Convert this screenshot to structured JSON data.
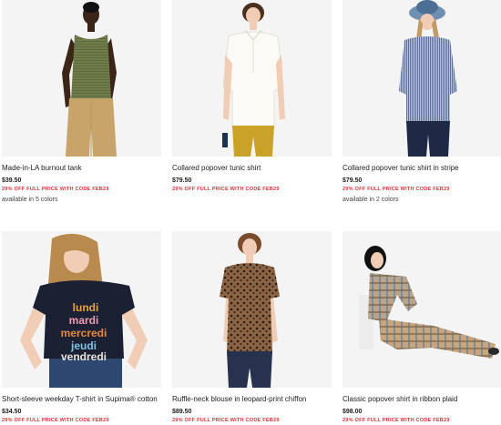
{
  "products": [
    {
      "name": "Made-in-LA burnout tank",
      "price": "$39.50",
      "promo": "29% OFF FULL PRICE WITH CODE FEB29",
      "colors": "available in 5 colors"
    },
    {
      "name": "Collared popover tunic shirt",
      "price": "$79.50",
      "promo": "29% OFF FULL PRICE WITH CODE FEB29"
    },
    {
      "name": "Collared popover tunic shirt in stripe",
      "price": "$79.50",
      "promo": "29% OFF FULL PRICE WITH CODE FEB29",
      "colors": "available in 2 colors"
    },
    {
      "name": "Short-sleeve weekday T-shirt in Supima® cotton",
      "price": "$34.50",
      "promo": "29% OFF FULL PRICE WITH CODE FEB29",
      "tee_lines": [
        "lundi",
        "mardi",
        "mercredi",
        "jeudi",
        "vendredi"
      ]
    },
    {
      "name": "Ruffle-neck blouse in leopard-print chiffon",
      "price": "$89.50",
      "promo": "29% OFF FULL PRICE WITH CODE FEB29"
    },
    {
      "name": "Classic popover shirt in ribbon plaid",
      "price": "$98.00",
      "promo": "29% OFF FULL PRICE WITH CODE FEB29"
    }
  ],
  "colors": {
    "promo": "#d6343b",
    "image_bg": "#f3f3f3",
    "text": "#1c1c1c"
  }
}
